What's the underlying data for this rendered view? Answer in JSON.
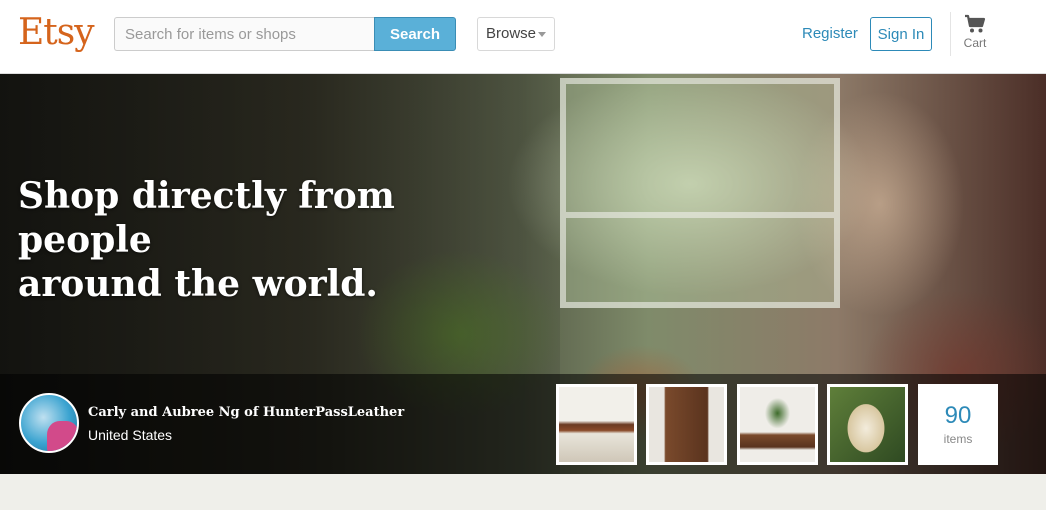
{
  "header": {
    "logo": "Etsy",
    "search_placeholder": "Search for items or shops",
    "search_button": "Search",
    "browse_label": "Browse",
    "register_label": "Register",
    "signin_label": "Sign In",
    "cart_label": "Cart",
    "cart_icon": "shopping-cart-icon"
  },
  "hero": {
    "headline_line1": "Shop directly from people",
    "headline_line2": "around the world.",
    "seller": {
      "name": "Carly and Aubree Ng of HunterPassLeather",
      "location": "United States"
    },
    "items_count": "90",
    "items_label": "items"
  },
  "colors": {
    "brand": "#d5641c",
    "link": "#2d8ab8",
    "search_button": "#5ab0d8"
  }
}
